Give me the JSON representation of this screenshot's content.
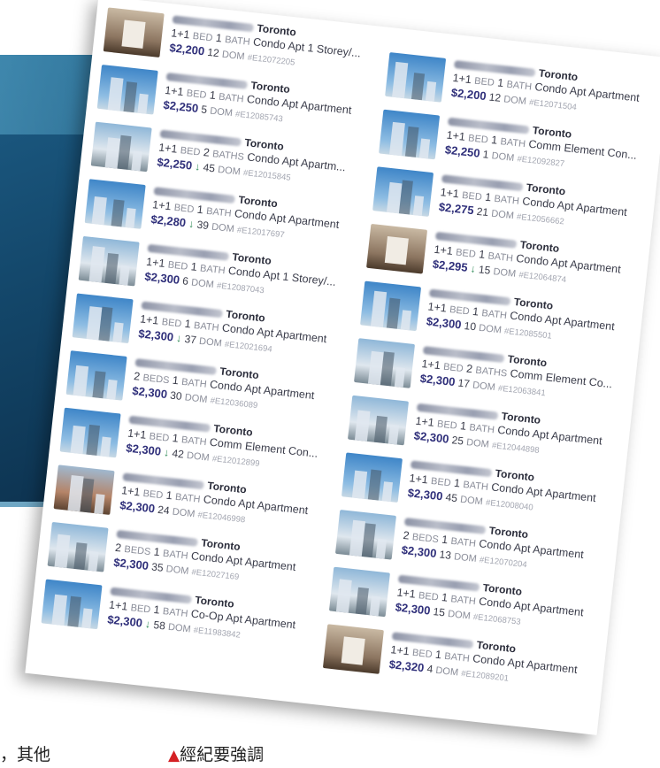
{
  "caption": {
    "left_text": "，其他",
    "marker": "▲",
    "text": "經紀要強調"
  },
  "listings_left": [
    {
      "photo": "interior-kitchen",
      "city": "Toronto",
      "beds": "1+1",
      "baths": "1",
      "bed_label": "BED",
      "bath_label": "BATH",
      "type": "Condo Apt 1 Storey/...",
      "price": "$2,200",
      "price_drop": false,
      "dom": "12",
      "mls": "#E12072205"
    },
    {
      "photo": "tower-sky",
      "city": "Toronto",
      "beds": "1+1",
      "baths": "1",
      "bed_label": "BED",
      "bath_label": "BATH",
      "type": "Condo Apt Apartment",
      "price": "$2,250",
      "price_drop": false,
      "dom": "5",
      "mls": "#E12085743"
    },
    {
      "photo": "tower-street",
      "city": "Toronto",
      "beds": "1+1",
      "baths": "2",
      "bed_label": "BED",
      "bath_label": "BATHS",
      "type": "Condo Apt Apartm...",
      "price": "$2,250",
      "price_drop": true,
      "dom": "45",
      "mls": "#E12015845"
    },
    {
      "photo": "tower-sky",
      "city": "Toronto",
      "beds": "1+1",
      "baths": "1",
      "bed_label": "BED",
      "bath_label": "BATH",
      "type": "Condo Apt Apartment",
      "price": "$2,280",
      "price_drop": true,
      "dom": "39",
      "mls": "#E12017697"
    },
    {
      "photo": "building-grey",
      "city": "Toronto",
      "beds": "1+1",
      "baths": "1",
      "bed_label": "BED",
      "bath_label": "BATH",
      "type": "Condo Apt 1 Storey/...",
      "price": "$2,300",
      "price_drop": false,
      "dom": "6",
      "mls": "#E12087043"
    },
    {
      "photo": "tower-sky",
      "city": "Toronto",
      "beds": "1+1",
      "baths": "1",
      "bed_label": "BED",
      "bath_label": "BATH",
      "type": "Condo Apt Apartment",
      "price": "$2,300",
      "price_drop": true,
      "dom": "37",
      "mls": "#E12021694"
    },
    {
      "photo": "tower-sky",
      "city": "Toronto",
      "beds": "2",
      "baths": "1",
      "bed_label": "BEDS",
      "bath_label": "BATH",
      "type": "Condo Apt Apartment",
      "price": "$2,300",
      "price_drop": false,
      "dom": "30",
      "mls": "#E12036089"
    },
    {
      "photo": "tower-sky",
      "city": "Toronto",
      "beds": "1+1",
      "baths": "1",
      "bed_label": "BED",
      "bath_label": "BATH",
      "type": "Comm Element Con...",
      "price": "$2,300",
      "price_drop": true,
      "dom": "42",
      "mls": "#E12012899"
    },
    {
      "photo": "brick",
      "city": "Toronto",
      "beds": "1+1",
      "baths": "1",
      "bed_label": "BED",
      "bath_label": "BATH",
      "type": "Condo Apt Apartment",
      "price": "$2,300",
      "price_drop": false,
      "dom": "24",
      "mls": "#E12046998"
    },
    {
      "photo": "tower-street",
      "city": "Toronto",
      "beds": "2",
      "baths": "1",
      "bed_label": "BEDS",
      "bath_label": "BATH",
      "type": "Condo Apt Apartment",
      "price": "$2,300",
      "price_drop": false,
      "dom": "35",
      "mls": "#E12027169"
    },
    {
      "photo": "tower-sky",
      "city": "Toronto",
      "beds": "1+1",
      "baths": "1",
      "bed_label": "BED",
      "bath_label": "BATH",
      "type": "Co-Op Apt Apartment",
      "price": "$2,300",
      "price_drop": true,
      "dom": "58",
      "mls": "#E11983842"
    }
  ],
  "listings_right": [
    {
      "photo": "tower-sky",
      "city": "Toronto",
      "beds": "1+1",
      "baths": "1",
      "bed_label": "BED",
      "bath_label": "BATH",
      "type": "Condo Apt Apartment",
      "price": "$2,200",
      "price_drop": false,
      "dom": "12",
      "mls": "#E12071504"
    },
    {
      "photo": "tower-sky",
      "city": "Toronto",
      "beds": "1+1",
      "baths": "1",
      "bed_label": "BED",
      "bath_label": "BATH",
      "type": "Comm Element Con...",
      "price": "$2,250",
      "price_drop": false,
      "dom": "1",
      "mls": "#E12092827"
    },
    {
      "photo": "tower-sky",
      "city": "Toronto",
      "beds": "1+1",
      "baths": "1",
      "bed_label": "BED",
      "bath_label": "BATH",
      "type": "Condo Apt Apartment",
      "price": "$2,275",
      "price_drop": false,
      "dom": "21",
      "mls": "#E12056662"
    },
    {
      "photo": "interior-room",
      "city": "Toronto",
      "beds": "1+1",
      "baths": "1",
      "bed_label": "BED",
      "bath_label": "BATH",
      "type": "Condo Apt Apartment",
      "price": "$2,295",
      "price_drop": true,
      "dom": "15",
      "mls": "#E12064874"
    },
    {
      "photo": "tower-sky",
      "city": "Toronto",
      "beds": "1+1",
      "baths": "1",
      "bed_label": "BED",
      "bath_label": "BATH",
      "type": "Condo Apt Apartment",
      "price": "$2,300",
      "price_drop": false,
      "dom": "10",
      "mls": "#E12085501"
    },
    {
      "photo": "building-grey",
      "city": "Toronto",
      "beds": "1+1",
      "baths": "2",
      "bed_label": "BED",
      "bath_label": "BATHS",
      "type": "Comm Element Co...",
      "price": "$2,300",
      "price_drop": false,
      "dom": "17",
      "mls": "#E12063841"
    },
    {
      "photo": "tower-street",
      "city": "Toronto",
      "beds": "1+1",
      "baths": "1",
      "bed_label": "BED",
      "bath_label": "BATH",
      "type": "Condo Apt Apartment",
      "price": "$2,300",
      "price_drop": false,
      "dom": "25",
      "mls": "#E12044898"
    },
    {
      "photo": "tower-sky",
      "city": "Toronto",
      "beds": "1+1",
      "baths": "1",
      "bed_label": "BED",
      "bath_label": "BATH",
      "type": "Condo Apt Apartment",
      "price": "$2,300",
      "price_drop": false,
      "dom": "45",
      "mls": "#E12008040"
    },
    {
      "photo": "building-grey",
      "city": "Toronto",
      "beds": "2",
      "baths": "1",
      "bed_label": "BEDS",
      "bath_label": "BATH",
      "type": "Condo Apt Apartment",
      "price": "$2,300",
      "price_drop": false,
      "dom": "13",
      "mls": "#E12070204"
    },
    {
      "photo": "building-grey",
      "city": "Toronto",
      "beds": "1+1",
      "baths": "1",
      "bed_label": "BED",
      "bath_label": "BATH",
      "type": "Condo Apt Apartment",
      "price": "$2,300",
      "price_drop": false,
      "dom": "15",
      "mls": "#E12068753"
    },
    {
      "photo": "interior-room",
      "city": "Toronto",
      "beds": "1+1",
      "baths": "1",
      "bed_label": "BED",
      "bath_label": "BATH",
      "type": "Condo Apt Apartment",
      "price": "$2,320",
      "price_drop": false,
      "dom": "4",
      "mls": "#E12089201"
    }
  ],
  "dom_label": "DOM",
  "price_drop_arrow": "↓",
  "colors": {
    "price": "#2f2f7a",
    "drop_arrow": "#2e8b57",
    "caption_marker": "#d42024",
    "panel": "#134669"
  }
}
